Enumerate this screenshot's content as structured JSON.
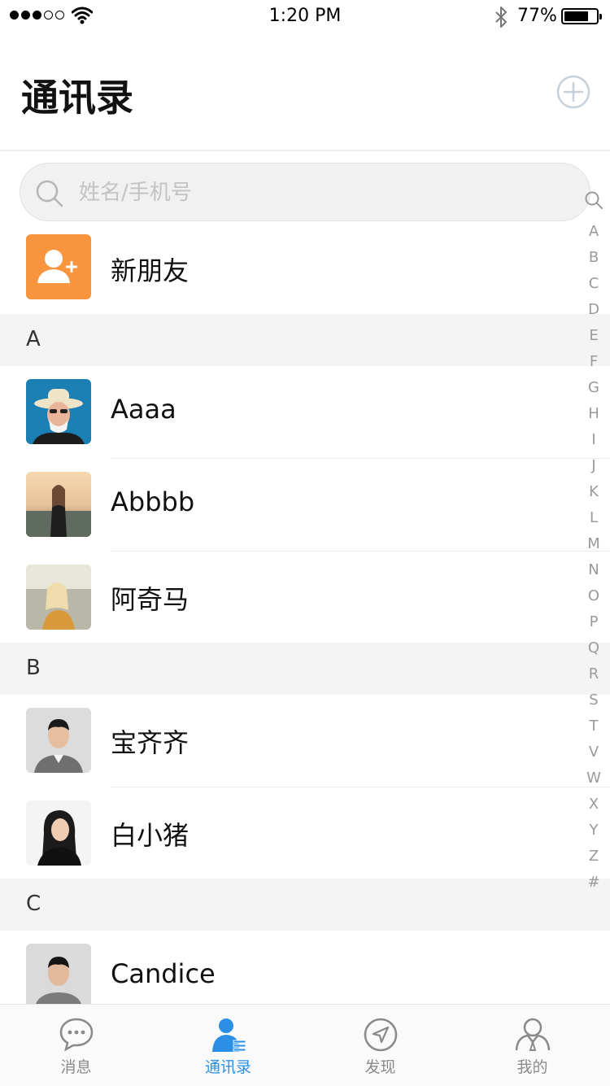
{
  "status_bar": {
    "time": "1:20 PM",
    "battery_percent": "77%",
    "battery_level": 0.77,
    "signal_bars": 3,
    "signal_total": 5
  },
  "header": {
    "title": "通讯录",
    "add_icon": "plus-circle-icon"
  },
  "search": {
    "placeholder": "姓名/手机号",
    "value": ""
  },
  "new_friends": {
    "label": "新朋友",
    "icon": "add-user-icon",
    "icon_bg": "#f8953e"
  },
  "sections": [
    {
      "letter": "A",
      "contacts": [
        {
          "name": "Aaaa"
        },
        {
          "name": "Abbbb"
        },
        {
          "name": "阿奇马"
        }
      ]
    },
    {
      "letter": "B",
      "contacts": [
        {
          "name": "宝齐齐"
        },
        {
          "name": "白小猪"
        }
      ]
    },
    {
      "letter": "C",
      "contacts": [
        {
          "name": "Candice"
        }
      ]
    }
  ],
  "index_letters": [
    "A",
    "B",
    "C",
    "D",
    "E",
    "F",
    "G",
    "H",
    "I",
    "J",
    "K",
    "L",
    "M",
    "N",
    "O",
    "P",
    "Q",
    "R",
    "S",
    "T",
    "V",
    "W",
    "X",
    "Y",
    "Z",
    "#"
  ],
  "tabs": [
    {
      "label": "消息",
      "icon": "chat-bubble-icon",
      "active": false
    },
    {
      "label": "通讯录",
      "icon": "contacts-icon",
      "active": true
    },
    {
      "label": "发现",
      "icon": "compass-icon",
      "active": false
    },
    {
      "label": "我的",
      "icon": "profile-icon",
      "active": false
    }
  ],
  "colors": {
    "accent": "#2b8fe6",
    "section_bg": "#f4f4f4",
    "inactive_tab": "#8a8a8a"
  }
}
